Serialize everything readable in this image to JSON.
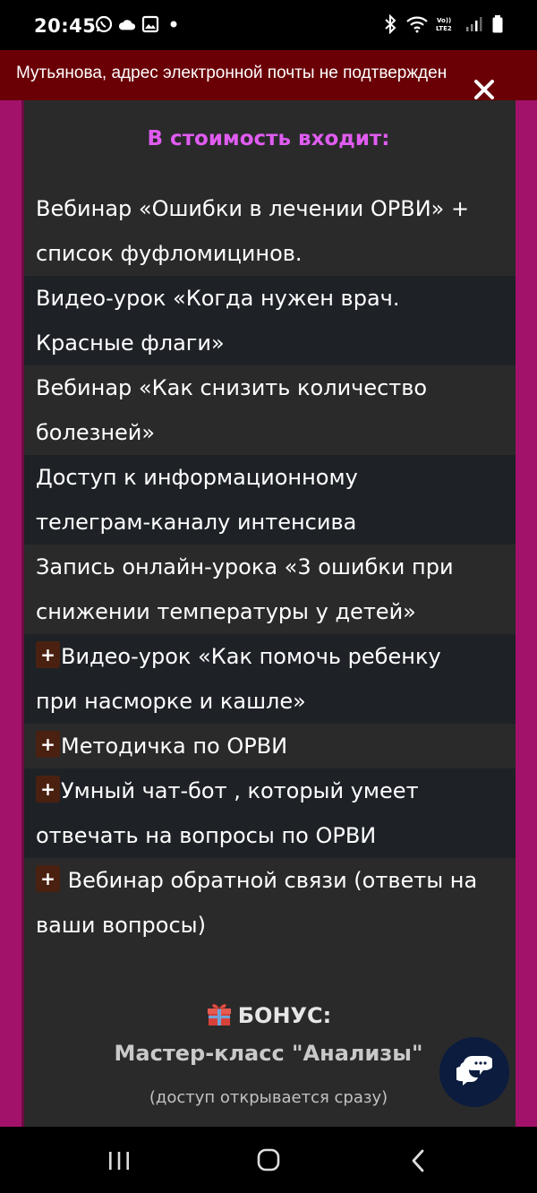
{
  "status_bar": {
    "time": "20:45",
    "left_icons": [
      "whatsapp-icon",
      "cloud-icon",
      "gallery-icon",
      "dot-icon"
    ],
    "right_icons": [
      "bluetooth-icon",
      "wifi-icon",
      "volte-icon",
      "signal-icon",
      "battery-icon"
    ],
    "volte_label": "Vo)) LTE2"
  },
  "banner": {
    "text": "Мутьянова, адрес электронной почты не подтвержден",
    "close_icon": "close-icon"
  },
  "section": {
    "title": "В стоимость входит:"
  },
  "items": [
    {
      "plus": false,
      "lines": [
        "Вебинар «Ошибки в лечении ОРВИ» +",
        "список фуфломицинов."
      ]
    },
    {
      "plus": false,
      "lines": [
        "Видео-урок «Когда нужен врач.",
        "Красные флаги»"
      ]
    },
    {
      "plus": false,
      "lines": [
        "Вебинар «Как снизить количество",
        "болезней»"
      ]
    },
    {
      "plus": false,
      "lines": [
        "Доступ к информационному",
        "телеграм-каналу интенсива"
      ]
    },
    {
      "plus": false,
      "lines": [
        "Запись онлайн-урока «3 ошибки при",
        "снижении температуры у детей»"
      ]
    },
    {
      "plus": true,
      "lines": [
        "Видео-урок «Как помочь ребенку",
        "при насморке и кашле»"
      ]
    },
    {
      "plus": true,
      "lines": [
        "Методичка по ОРВИ"
      ]
    },
    {
      "plus": true,
      "lines": [
        "Умный чат-бот , который умеет",
        "отвечать на вопросы по ОРВИ"
      ]
    },
    {
      "plus": true,
      "lines": [
        " Вебинар обратной связи (ответы на",
        "ваши вопросы)"
      ]
    }
  ],
  "plus_symbol": "+",
  "bonus": {
    "label": "БОНУС:",
    "icon": "gift-icon",
    "title": "Мастер-класс \"Анализы\"",
    "note": "(доступ открывается сразу)"
  },
  "chat": {
    "icon": "chat-bubbles-icon"
  },
  "nav_bar": {
    "icons": [
      "recent-apps-icon",
      "home-icon",
      "back-icon"
    ]
  },
  "colors": {
    "accent_pink": "#e05cf0",
    "page_magenta": "#a3126a",
    "banner_red": "#6a0006",
    "card_bg": "#2a2a2b",
    "row_alt_bg": "#1e2227",
    "plus_badge": "#4a2110",
    "chat_button": "#0b1c3e"
  }
}
